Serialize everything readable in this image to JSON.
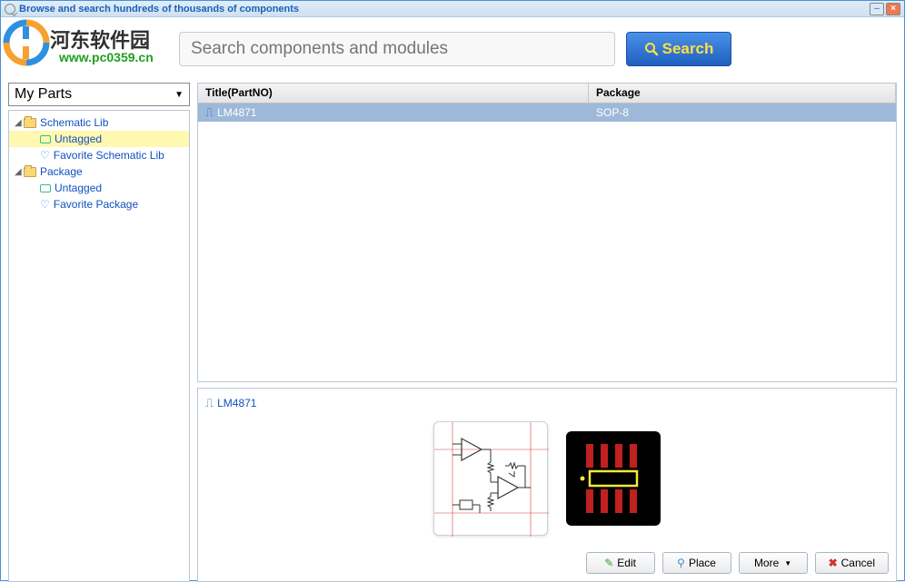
{
  "window": {
    "title": "Browse and search hundreds of thousands of components"
  },
  "watermark": {
    "text": "河东软件园",
    "url": "www.pc0359.cn"
  },
  "search": {
    "placeholder": "Search components and modules",
    "button": "Search"
  },
  "sidebar": {
    "dropdown": "My Parts",
    "tree": [
      {
        "label": "Schematic Lib",
        "children": [
          {
            "label": "Untagged",
            "icon": "tag",
            "selected": true
          },
          {
            "label": "Favorite Schematic Lib",
            "icon": "heart"
          }
        ]
      },
      {
        "label": "Package",
        "children": [
          {
            "label": "Untagged",
            "icon": "tag"
          },
          {
            "label": "Favorite Package",
            "icon": "heart"
          }
        ]
      }
    ]
  },
  "table": {
    "headers": {
      "title": "Title(PartNO)",
      "package": "Package"
    },
    "rows": [
      {
        "title": "LM4871",
        "package": "SOP-8",
        "selected": true
      }
    ]
  },
  "preview": {
    "title": "LM4871"
  },
  "buttons": {
    "edit": "Edit",
    "place": "Place",
    "more": "More",
    "cancel": "Cancel"
  }
}
